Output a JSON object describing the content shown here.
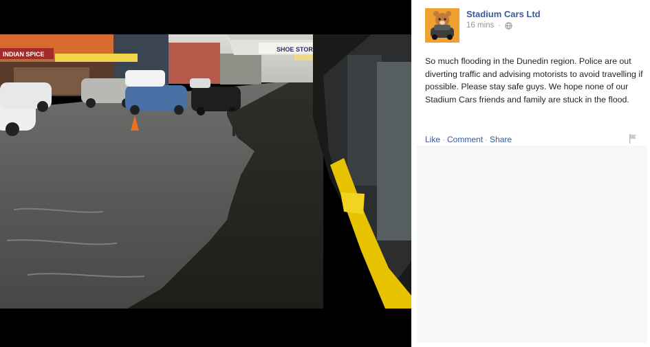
{
  "post": {
    "page_name": "Stadium Cars Ltd",
    "timestamp": "16 mins",
    "privacy_icon": "globe-icon",
    "text": "So much flooding in the Dunedin region. Police are out diverting traffic and advising motorists to avoid travelling if possible. Please stay safe guys. We hope none of our Stadium Cars friends and family are stuck in the flood.",
    "avatar_icon": "teddy-bear-car-logo"
  },
  "actions": {
    "like": "Like",
    "comment": "Comment",
    "share": "Share",
    "separator": "·"
  },
  "photo": {
    "shop_sign": "SHOE STORE",
    "left_sign": "INDIAN SPICE",
    "colors": {
      "water": "#4a4a48",
      "shop_yellow": "#e6c200",
      "awning": "#d45a2a"
    }
  },
  "colors": {
    "link": "#3b5998",
    "action_link": "#365899",
    "meta": "#90949c",
    "body_text": "#1d2129",
    "comment_bg": "#f6f7f9"
  }
}
